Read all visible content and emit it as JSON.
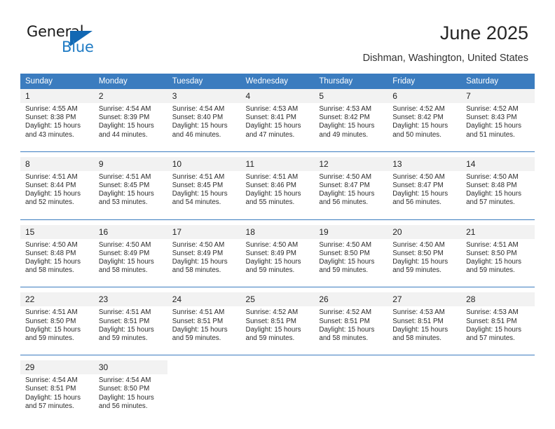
{
  "brand": {
    "name_top": "General",
    "name_bottom": "Blue",
    "accent_color": "#1f7bc4",
    "triangle_color": "#1268b3"
  },
  "header": {
    "title": "June 2025",
    "location": "Dishman, Washington, United States"
  },
  "calendar": {
    "header_bg": "#3b7cbf",
    "daynum_bg": "#f2f2f2",
    "weekdays": [
      "Sunday",
      "Monday",
      "Tuesday",
      "Wednesday",
      "Thursday",
      "Friday",
      "Saturday"
    ],
    "weeks": [
      [
        {
          "day": "1",
          "sunrise": "Sunrise: 4:55 AM",
          "sunset": "Sunset: 8:38 PM",
          "daylight1": "Daylight: 15 hours",
          "daylight2": "and 43 minutes."
        },
        {
          "day": "2",
          "sunrise": "Sunrise: 4:54 AM",
          "sunset": "Sunset: 8:39 PM",
          "daylight1": "Daylight: 15 hours",
          "daylight2": "and 44 minutes."
        },
        {
          "day": "3",
          "sunrise": "Sunrise: 4:54 AM",
          "sunset": "Sunset: 8:40 PM",
          "daylight1": "Daylight: 15 hours",
          "daylight2": "and 46 minutes."
        },
        {
          "day": "4",
          "sunrise": "Sunrise: 4:53 AM",
          "sunset": "Sunset: 8:41 PM",
          "daylight1": "Daylight: 15 hours",
          "daylight2": "and 47 minutes."
        },
        {
          "day": "5",
          "sunrise": "Sunrise: 4:53 AM",
          "sunset": "Sunset: 8:42 PM",
          "daylight1": "Daylight: 15 hours",
          "daylight2": "and 49 minutes."
        },
        {
          "day": "6",
          "sunrise": "Sunrise: 4:52 AM",
          "sunset": "Sunset: 8:42 PM",
          "daylight1": "Daylight: 15 hours",
          "daylight2": "and 50 minutes."
        },
        {
          "day": "7",
          "sunrise": "Sunrise: 4:52 AM",
          "sunset": "Sunset: 8:43 PM",
          "daylight1": "Daylight: 15 hours",
          "daylight2": "and 51 minutes."
        }
      ],
      [
        {
          "day": "8",
          "sunrise": "Sunrise: 4:51 AM",
          "sunset": "Sunset: 8:44 PM",
          "daylight1": "Daylight: 15 hours",
          "daylight2": "and 52 minutes."
        },
        {
          "day": "9",
          "sunrise": "Sunrise: 4:51 AM",
          "sunset": "Sunset: 8:45 PM",
          "daylight1": "Daylight: 15 hours",
          "daylight2": "and 53 minutes."
        },
        {
          "day": "10",
          "sunrise": "Sunrise: 4:51 AM",
          "sunset": "Sunset: 8:45 PM",
          "daylight1": "Daylight: 15 hours",
          "daylight2": "and 54 minutes."
        },
        {
          "day": "11",
          "sunrise": "Sunrise: 4:51 AM",
          "sunset": "Sunset: 8:46 PM",
          "daylight1": "Daylight: 15 hours",
          "daylight2": "and 55 minutes."
        },
        {
          "day": "12",
          "sunrise": "Sunrise: 4:50 AM",
          "sunset": "Sunset: 8:47 PM",
          "daylight1": "Daylight: 15 hours",
          "daylight2": "and 56 minutes."
        },
        {
          "day": "13",
          "sunrise": "Sunrise: 4:50 AM",
          "sunset": "Sunset: 8:47 PM",
          "daylight1": "Daylight: 15 hours",
          "daylight2": "and 56 minutes."
        },
        {
          "day": "14",
          "sunrise": "Sunrise: 4:50 AM",
          "sunset": "Sunset: 8:48 PM",
          "daylight1": "Daylight: 15 hours",
          "daylight2": "and 57 minutes."
        }
      ],
      [
        {
          "day": "15",
          "sunrise": "Sunrise: 4:50 AM",
          "sunset": "Sunset: 8:48 PM",
          "daylight1": "Daylight: 15 hours",
          "daylight2": "and 58 minutes."
        },
        {
          "day": "16",
          "sunrise": "Sunrise: 4:50 AM",
          "sunset": "Sunset: 8:49 PM",
          "daylight1": "Daylight: 15 hours",
          "daylight2": "and 58 minutes."
        },
        {
          "day": "17",
          "sunrise": "Sunrise: 4:50 AM",
          "sunset": "Sunset: 8:49 PM",
          "daylight1": "Daylight: 15 hours",
          "daylight2": "and 58 minutes."
        },
        {
          "day": "18",
          "sunrise": "Sunrise: 4:50 AM",
          "sunset": "Sunset: 8:49 PM",
          "daylight1": "Daylight: 15 hours",
          "daylight2": "and 59 minutes."
        },
        {
          "day": "19",
          "sunrise": "Sunrise: 4:50 AM",
          "sunset": "Sunset: 8:50 PM",
          "daylight1": "Daylight: 15 hours",
          "daylight2": "and 59 minutes."
        },
        {
          "day": "20",
          "sunrise": "Sunrise: 4:50 AM",
          "sunset": "Sunset: 8:50 PM",
          "daylight1": "Daylight: 15 hours",
          "daylight2": "and 59 minutes."
        },
        {
          "day": "21",
          "sunrise": "Sunrise: 4:51 AM",
          "sunset": "Sunset: 8:50 PM",
          "daylight1": "Daylight: 15 hours",
          "daylight2": "and 59 minutes."
        }
      ],
      [
        {
          "day": "22",
          "sunrise": "Sunrise: 4:51 AM",
          "sunset": "Sunset: 8:50 PM",
          "daylight1": "Daylight: 15 hours",
          "daylight2": "and 59 minutes."
        },
        {
          "day": "23",
          "sunrise": "Sunrise: 4:51 AM",
          "sunset": "Sunset: 8:51 PM",
          "daylight1": "Daylight: 15 hours",
          "daylight2": "and 59 minutes."
        },
        {
          "day": "24",
          "sunrise": "Sunrise: 4:51 AM",
          "sunset": "Sunset: 8:51 PM",
          "daylight1": "Daylight: 15 hours",
          "daylight2": "and 59 minutes."
        },
        {
          "day": "25",
          "sunrise": "Sunrise: 4:52 AM",
          "sunset": "Sunset: 8:51 PM",
          "daylight1": "Daylight: 15 hours",
          "daylight2": "and 59 minutes."
        },
        {
          "day": "26",
          "sunrise": "Sunrise: 4:52 AM",
          "sunset": "Sunset: 8:51 PM",
          "daylight1": "Daylight: 15 hours",
          "daylight2": "and 58 minutes."
        },
        {
          "day": "27",
          "sunrise": "Sunrise: 4:53 AM",
          "sunset": "Sunset: 8:51 PM",
          "daylight1": "Daylight: 15 hours",
          "daylight2": "and 58 minutes."
        },
        {
          "day": "28",
          "sunrise": "Sunrise: 4:53 AM",
          "sunset": "Sunset: 8:51 PM",
          "daylight1": "Daylight: 15 hours",
          "daylight2": "and 57 minutes."
        }
      ],
      [
        {
          "day": "29",
          "sunrise": "Sunrise: 4:54 AM",
          "sunset": "Sunset: 8:51 PM",
          "daylight1": "Daylight: 15 hours",
          "daylight2": "and 57 minutes."
        },
        {
          "day": "30",
          "sunrise": "Sunrise: 4:54 AM",
          "sunset": "Sunset: 8:50 PM",
          "daylight1": "Daylight: 15 hours",
          "daylight2": "and 56 minutes."
        },
        {
          "day": "",
          "sunrise": "",
          "sunset": "",
          "daylight1": "",
          "daylight2": ""
        },
        {
          "day": "",
          "sunrise": "",
          "sunset": "",
          "daylight1": "",
          "daylight2": ""
        },
        {
          "day": "",
          "sunrise": "",
          "sunset": "",
          "daylight1": "",
          "daylight2": ""
        },
        {
          "day": "",
          "sunrise": "",
          "sunset": "",
          "daylight1": "",
          "daylight2": ""
        },
        {
          "day": "",
          "sunrise": "",
          "sunset": "",
          "daylight1": "",
          "daylight2": ""
        }
      ]
    ]
  }
}
